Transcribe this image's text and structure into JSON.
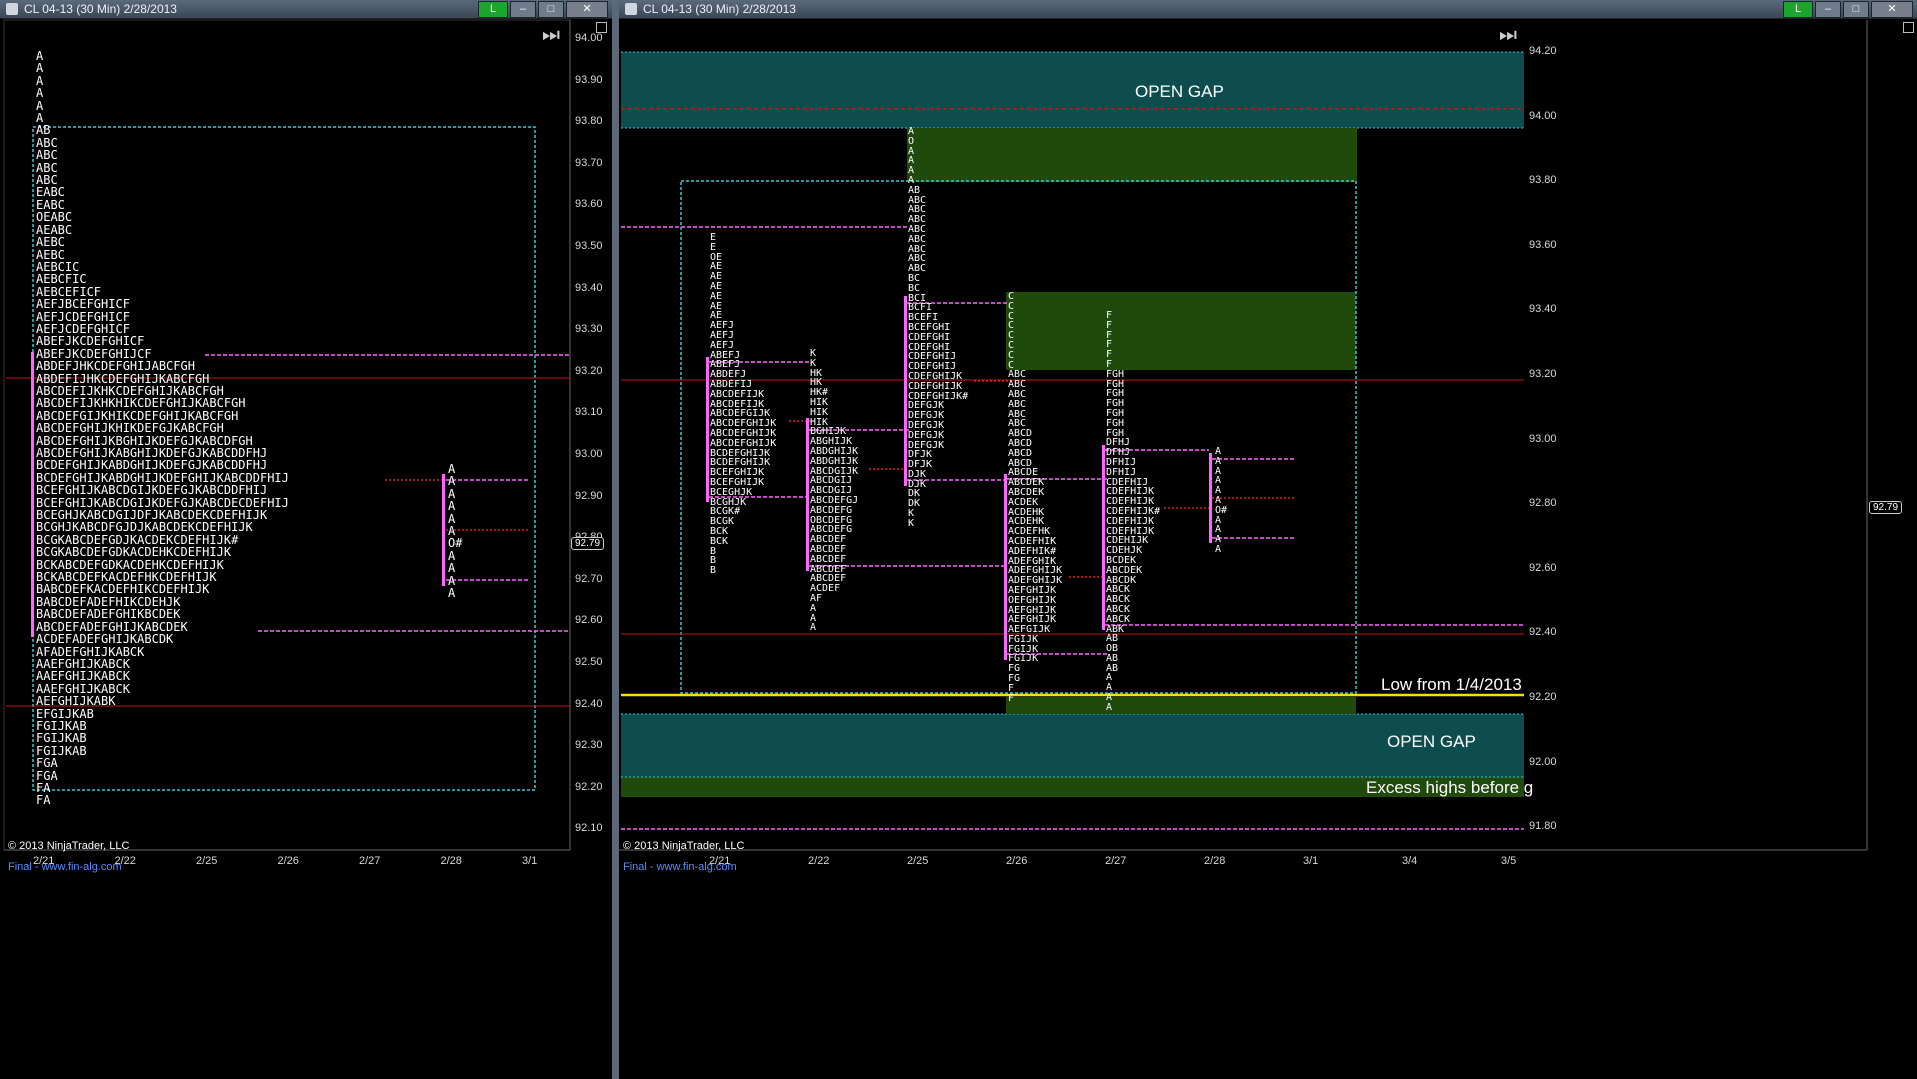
{
  "left_window": {
    "title": "CL 04-13 (30 Min)  2/28/2013",
    "status_button": "L",
    "price_axis": [
      "94.00",
      "93.90",
      "93.80",
      "93.70",
      "93.60",
      "93.50",
      "93.40",
      "93.30",
      "93.20",
      "93.10",
      "93.00",
      "92.90",
      "92.80",
      "92.70",
      "92.60",
      "92.50",
      "92.40",
      "92.30",
      "92.20",
      "92.10"
    ],
    "date_axis": [
      "2/21",
      "2/22",
      "2/25",
      "2/26",
      "2/27",
      "2/28",
      "3/1"
    ],
    "current_price": "92.79",
    "copyright": "© 2013 NinjaTrader, LLC",
    "footer_link": "Final - www.fin-alg.com",
    "composite_profile": [
      "A",
      "A",
      "A",
      "A",
      "A",
      "A",
      "AB",
      "ABC",
      "ABC",
      "ABC",
      "ABC",
      "EABC",
      "EABC",
      "OEABC",
      "AEABC",
      "AEBC",
      "AEBC",
      "AEBCIC",
      "AEBCFIC",
      "AEBCEFICF",
      "AEFJBCEFGHICF",
      "AEFJCDEFGHICF",
      "AEFJCDEFGHICF",
      "ABEFJKCDEFGHICF",
      "ABEFJKCDEFGHIJCF",
      "ABDEFJHKCDEFGHIJABCFGH",
      "ABDEFIJHKCDEFGHIJKABCFGH",
      "ABCDEFIJKHKCDEFGHIJKABCFGH",
      "ABCDEFIJKHKHIKCDEFGHIJKABCFGH",
      "ABCDEFGIJKHIKCDEFGHIJKABCFGH",
      "ABCDEFGHIJKHIKDEFGJKABCFGH",
      "ABCDEFGHIJKBGHIJKDEFGJKABCDFGH",
      "ABCDEFGHIJKABGHIJKDEFGJKABCDDFHJ",
      "BCDEFGHIJKABDGHIJKDEFGJKABCDDFHJ",
      "BCDEFGHIJKABDGHIJKDEFGHIJKABCDDFHIJ",
      "BCEFGHIJKABCDGIJKDEFGJKABCDDFHIJ",
      "BCEFGHIJKABCDGIJKDEFGJKABCDECDEFHIJ",
      "BCEGHJKABCDGIJDFJKABCDEKCDEFHIJK",
      "BCGHJKABCDFGJDJKABCDEKCDEFHIJK",
      "BCGKABCDEFGDJKACDEKCDEFHIJK#",
      "BCGKABCDEFGDKACDEHKCDEFHIJK",
      "BCKABCDEFGDKACDEHKCDEFHIJK",
      "BCKABCDEFKACDEFHKCDEFHIJK",
      "BABCDEFKACDEFHIKCDEFHIJK",
      "BABCDEFADEFHIKCDEHJK",
      "BABCDEFADEFGHIKBCDEK",
      "ABCDEFADEFGHIJKABCDEK",
      "ACDEFADEFGHIJKABCDK",
      "AFADEFGHIJKABCK",
      "AAEFGHIJKABCK",
      "AAEFGHIJKABCK",
      "AAEFGHIJKABCK",
      "AEFGHIJKABK",
      "EFGIJKAB",
      "FGIJKAB",
      "FGIJKAB",
      "FGIJKAB",
      "FGA",
      "FGA",
      "FA",
      "FA"
    ],
    "day_profile": "A\nA\nA\nA\nA\nA\nO#\nA\nA\nA\nA"
  },
  "right_window": {
    "title": "CL 04-13 (30 Min)  2/28/2013",
    "status_button": "L",
    "price_axis": [
      "94.20",
      "94.00",
      "93.80",
      "93.60",
      "93.40",
      "93.20",
      "93.00",
      "92.80",
      "92.60",
      "92.40",
      "92.20",
      "92.00",
      "91.80"
    ],
    "date_axis": [
      "2/21",
      "2/22",
      "2/25",
      "2/26",
      "2/27",
      "2/28",
      "3/1",
      "3/4",
      "3/5"
    ],
    "current_price": "92.79",
    "copyright": "© 2013 NinjaTrader, LLC",
    "footer_link": "Final - www.fin-alg.com",
    "annotations": {
      "open_gap_top": "OPEN GAP",
      "open_gap_bottom": "OPEN GAP",
      "low_label": "Low from 1/4/2013",
      "excess_label": "Excess highs before g"
    },
    "profiles": [
      "E\nE\nOE\nAE\nAE\nAE\nAE\nAE\nAE\nAEFJ\nAEFJ\nAEFJ\nABEFJ\nABEFJ\nABDEFJ\nABDEFIJ\nABCDEFIJK\nABCDEFIJK\nABCDEFGIJK\nABCDEFGHIJK\nABCDEFGHIJK\nABCDEFGHIJK\nBCDEFGHIJK\nBCDEFGHIJK\nBCEFGHIJK\nBCEFGHIJK\nBCEGHJK\nBCGHJK\nBCGK#\nBCGK\nBCK\nBCK\nB\nB\nB",
      "K\nK\nHK\nHK\nHK#\nHIK\nHIK\nHIK\nBGHIJK\nABGHIJK\nABDGHIJK\nABDGHIJK\nABCDGIJK\nABCDGIJ\nABCDGIJ\nABCDEFGJ\nABCDEFG\nOBCDEFG\nABCDEFG\nABCDEF\nABCDEF\nABCDEF\nABCDEF\nABCDEF\nACDEF\nAF\nA\nA\nA",
      "A\nO\nA\nA\nA\nA\nAB\nABC\nABC\nABC\nABC\nABC\nABC\nABC\nABC\nBC\nBC\nBCI\nBCFI\nBCEFI\nBCEFGHI\nCDEFGHI\nCDEFGHI\nCDEFGHIJ\nCDEFGHIJ\nCDEFGHIJK\nCDEFGHIJK\nCDEFGHIJK#\nDEFGJK\nDEFGJK\nDEFGJK\nDEFGJK\nDEFGJK\nDFJK\nDFJK\nDJK\nDJK\nDK\nDK\nK\nK",
      "C\nC\nC\nC\nC\nC\nC\nC\nABC\nABC\nABC\nABC\nABC\nABC\nABCD\nABCD\nABCD\nABCD\nABCDE\nABCDEK\nABCDEK\nACDEK\nACDEHK\nACDEHK\nACDEFHK\nACDEFHIK\nADEFHIK#\nADEFGHIK\nADEFGHIJK\nADEFGHIJK\nAEFGHIJK\nOEFGHIJK\nAEFGHIJK\nAEFGHIJK\nAEFGIJK\nFGIJK\nFGIJK\nFGIJK\nFG\nFG\nF\nF",
      "F\nF\nF\nF\nF\nF\nFGH\nFGH\nFGH\nFGH\nFGH\nFGH\nFGH\nDFHJ\nDFHJ\nDFHIJ\nDFHIJ\nCDEFHIJ\nCDEFHIJK\nCDEFHIJK\nCDEFHIJK#\nCDEFHIJK\nCDEFHIJK\nCDEHIJK\nCDEHJK\nBCDEK\nABCDEK\nABCDK\nABCK\nABCK\nABCK\nABCK\nABK\nAB\nOB\nAB\nAB\nA\nA\nA\nA",
      "A\nA\nA\nA\nA\nA\nO#\nA\nA\nA\nA"
    ]
  },
  "colors": {
    "gap_zone": "#0d4d4e",
    "green_zone": "#1f4a0c",
    "va_box": "#39c7d8",
    "poc_line": "#ff66ff",
    "red_line": "#d01010",
    "yellow_line": "#f2e200",
    "profile_bar": "#ff66ff"
  }
}
